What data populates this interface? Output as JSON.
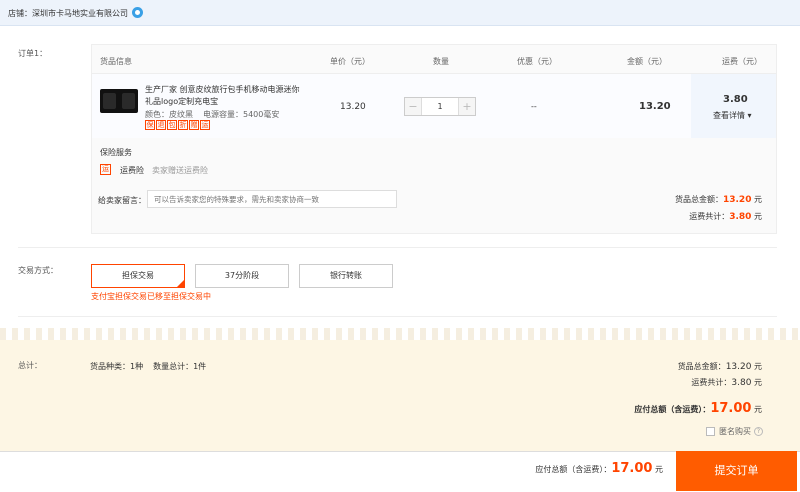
{
  "shop": {
    "label": "店铺：",
    "name": "深圳市卡马地实业有限公司",
    "icon": "wangwang-icon"
  },
  "order": {
    "label": "订单1：",
    "headers": [
      "货品信息",
      "单价（元）",
      "数量",
      "优惠（元）",
      "金额（元）",
      "运费（元）"
    ],
    "product": {
      "title": "生产厂家 创意皮纹旅行包手机移动电源迷你礼品logo定制充电宝",
      "color": "颜色：皮纹黑",
      "capacity": "电源容量：5400毫安",
      "badges": [
        "保",
        "退",
        "包",
        "折",
        "赠",
        "运"
      ],
      "unit_price": "13.20",
      "quantity": "1",
      "discount": "--",
      "amount": "13.20",
      "freight": "3.80",
      "freight_detail": "查看详情 ▾"
    },
    "insurance": {
      "title": "保险服务",
      "icon_text": "运",
      "name": "运费险",
      "desc": "卖家赠送运费险"
    },
    "message": {
      "label": "给卖家留言：",
      "placeholder": "可以告诉卖家您的特殊要求，需先和卖家协商一致"
    },
    "subtotal": {
      "goods_label": "货品总金额：",
      "goods_value": "13.20",
      "freight_label": "运费共计：",
      "freight_value": "3.80",
      "unit": "元"
    }
  },
  "payment": {
    "label": "交易方式：",
    "options": [
      "担保交易",
      "37分阶段",
      "银行转账"
    ],
    "selected": 0,
    "note": "支付宝担保交易已移至担保交易中"
  },
  "summary": {
    "label": "总计：",
    "kinds": "货品种类：1种",
    "count": "数量总计：1件",
    "goods_label": "货品总金额：",
    "goods_value": "13.20",
    "freight_label": "运费共计：",
    "freight_value": "3.80",
    "unit": "元",
    "total_label": "应付总额（含运费）：",
    "total_value": "17.00",
    "anonymous": "匿名购买"
  },
  "bottom": {
    "total_label": "应付总额（含运费）：",
    "total_value": "17.00",
    "unit": "元",
    "submit": "提交订单"
  },
  "colors": {
    "accent": "#ff5c00",
    "price": "#ff4400",
    "summary_bg": "#fdf6e4",
    "shopbar_bg": "#edf3fb"
  }
}
